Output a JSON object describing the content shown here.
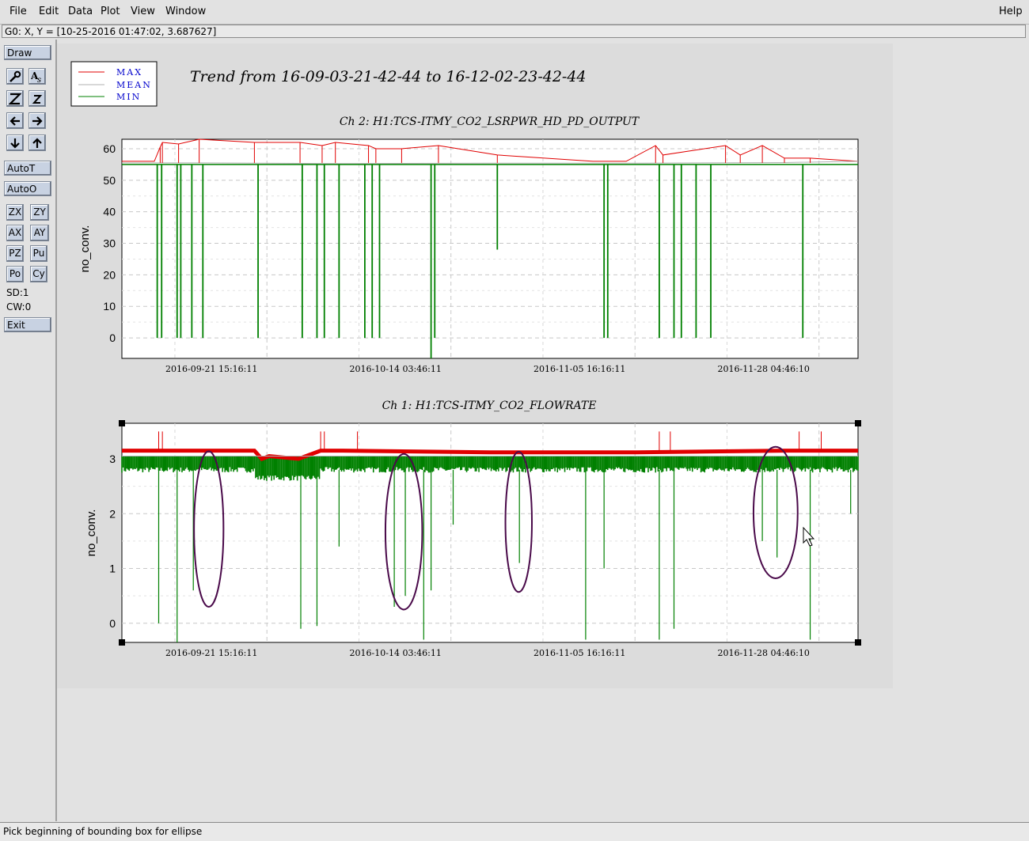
{
  "menu": {
    "file": "File",
    "edit": "Edit",
    "data": "Data",
    "plot": "Plot",
    "view": "View",
    "window": "Window",
    "help": "Help"
  },
  "coord_readout": "G0: X, Y = [10-25-2016 01:47:02, 3.687627]",
  "toolbar": {
    "draw": "Draw",
    "autot": "AutoT",
    "autoo": "AutoO",
    "zx": "ZX",
    "zy": "ZY",
    "ax": "AX",
    "ay": "AY",
    "pz": "PZ",
    "pu": "Pu",
    "po": "Po",
    "cy": "Cy",
    "sd": "SD:1",
    "cw": "CW:0",
    "exit": "Exit"
  },
  "icons": [
    "pointer-wrench-icon",
    "text-a-icon",
    "zoom-big-z-icon",
    "zoom-small-z-icon",
    "left-arrow-icon",
    "right-arrow-icon",
    "down-arrow-icon",
    "up-arrow-icon"
  ],
  "status": "Pick beginning of bounding box for ellipse",
  "colors": {
    "max": "#e00000",
    "mean": "#b0b0b0",
    "min": "#008000",
    "legend_text": "#0000cc",
    "annotation": "#4a0a4a",
    "button": "#c8d2e2"
  },
  "chart_data": [
    {
      "type": "line",
      "title": "Ch 2: H1:TCS-ITMY_CO2_LSRPWR_HD_PD_OUTPUT",
      "main_title": "Trend from 16-09-03-21-42-44 to 16-12-02-23-42-44",
      "ylabel": "no_conv.",
      "ylim": [
        -6.5,
        63
      ],
      "yticks": [
        0,
        10,
        20,
        30,
        40,
        50,
        60
      ],
      "xticks": [
        "2016-09-21 15:16:11",
        "2016-10-14 03:46:11",
        "2016-11-05 16:16:11",
        "2016-11-28 04:46:10"
      ],
      "xtick_pos": [
        0.197,
        0.447,
        0.697,
        0.947
      ],
      "grid": true,
      "legend": [
        "MAX",
        "MEAN",
        "MIN"
      ],
      "legend_position": "top-left",
      "series": [
        {
          "name": "MAX",
          "x": [
            0,
            0.044,
            0.052,
            0.055,
            0.077,
            0.105,
            0.18,
            0.242,
            0.272,
            0.29,
            0.335,
            0.345,
            0.38,
            0.43,
            0.51,
            0.64,
            0.685,
            0.725,
            0.735,
            0.82,
            0.84,
            0.87,
            0.9,
            0.935,
            1.0
          ],
          "values": [
            56,
            56,
            60.5,
            62,
            61.5,
            63,
            62,
            62,
            61,
            62,
            61,
            60,
            60,
            61,
            58,
            56,
            56,
            61,
            58,
            61,
            58,
            61,
            57,
            57,
            56
          ]
        },
        {
          "name": "MEAN",
          "x": [
            0,
            0.1,
            0.3,
            0.5,
            0.7,
            0.9,
            1.0
          ],
          "values": [
            55.5,
            55.5,
            55.3,
            55.4,
            55.4,
            55.6,
            56
          ]
        },
        {
          "name": "MIN",
          "x": [
            0,
            0.048,
            0.05,
            0.054,
            0.056,
            0.075,
            0.078,
            0.08,
            0.095,
            0.11,
            0.185,
            0.245,
            0.265,
            0.275,
            0.295,
            0.33,
            0.34,
            0.35,
            0.42,
            0.425,
            0.51,
            0.655,
            0.66,
            0.73,
            0.75,
            0.76,
            0.78,
            0.8,
            0.925
          ],
          "values": [
            55,
            0,
            55,
            0,
            55,
            0,
            55,
            0,
            0,
            0,
            0,
            0,
            0,
            0,
            0,
            0,
            0,
            0,
            -6.5,
            0,
            28,
            0,
            0,
            0,
            0,
            0,
            0,
            0,
            0
          ]
        }
      ]
    },
    {
      "type": "line",
      "title": "Ch 1: H1:TCS-ITMY_CO2_FLOWRATE",
      "ylabel": "no_conv.",
      "ylim": [
        -0.35,
        3.65
      ],
      "yticks": [
        0,
        1,
        2,
        3
      ],
      "xticks": [
        "2016-09-21 15:16:11",
        "2016-10-14 03:46:11",
        "2016-11-05 16:16:11",
        "2016-11-28 04:46:10"
      ],
      "xtick_pos": [
        0.197,
        0.447,
        0.697,
        0.947
      ],
      "grid": true,
      "series": [
        {
          "name": "MAX",
          "x": [
            0,
            0.18,
            0.19,
            0.2,
            0.24,
            0.27,
            0.3,
            0.5,
            0.7,
            0.9,
            1.0
          ],
          "values": [
            3.15,
            3.15,
            3.0,
            3.05,
            3.0,
            3.15,
            3.15,
            3.12,
            3.12,
            3.15,
            3.15
          ]
        },
        {
          "name": "MEAN",
          "x": [
            0,
            0.5,
            1.0
          ],
          "values": [
            3.05,
            3.05,
            3.05
          ]
        },
        {
          "name": "MIN",
          "x": [
            0,
            0.1,
            0.2,
            0.3,
            0.4,
            0.5,
            0.6,
            0.7,
            0.8,
            0.9,
            1.0
          ],
          "values": [
            2.8,
            2.8,
            2.7,
            2.8,
            2.8,
            2.8,
            2.8,
            2.8,
            2.8,
            2.8,
            2.8
          ]
        }
      ],
      "spikes_down": [
        [
          0.05,
          0.0
        ],
        [
          0.075,
          -0.35
        ],
        [
          0.097,
          0.6
        ],
        [
          0.243,
          -0.1
        ],
        [
          0.265,
          -0.05
        ],
        [
          0.295,
          1.4
        ],
        [
          0.37,
          0.3
        ],
        [
          0.385,
          0.5
        ],
        [
          0.41,
          -0.3
        ],
        [
          0.42,
          0.6
        ],
        [
          0.45,
          1.8
        ],
        [
          0.54,
          1.1
        ],
        [
          0.63,
          -0.3
        ],
        [
          0.655,
          1.0
        ],
        [
          0.73,
          -0.3
        ],
        [
          0.75,
          -0.1
        ],
        [
          0.87,
          1.5
        ],
        [
          0.89,
          1.2
        ],
        [
          0.935,
          -0.3
        ],
        [
          0.99,
          2.0
        ]
      ],
      "spikes_up": [
        0.05,
        0.055,
        0.27,
        0.275,
        0.32,
        0.73,
        0.745,
        0.92,
        0.95
      ],
      "annotations": [
        {
          "shape": "ellipse",
          "cx": 0.118,
          "cy": 1.72,
          "rx": 0.02,
          "ry": 1.42
        },
        {
          "shape": "ellipse",
          "cx": 0.383,
          "cy": 1.67,
          "rx": 0.025,
          "ry": 1.42
        },
        {
          "shape": "ellipse",
          "cx": 0.539,
          "cy": 1.85,
          "rx": 0.018,
          "ry": 1.28
        },
        {
          "shape": "ellipse",
          "cx": 0.888,
          "cy": 2.02,
          "rx": 0.03,
          "ry": 1.2
        }
      ]
    }
  ]
}
